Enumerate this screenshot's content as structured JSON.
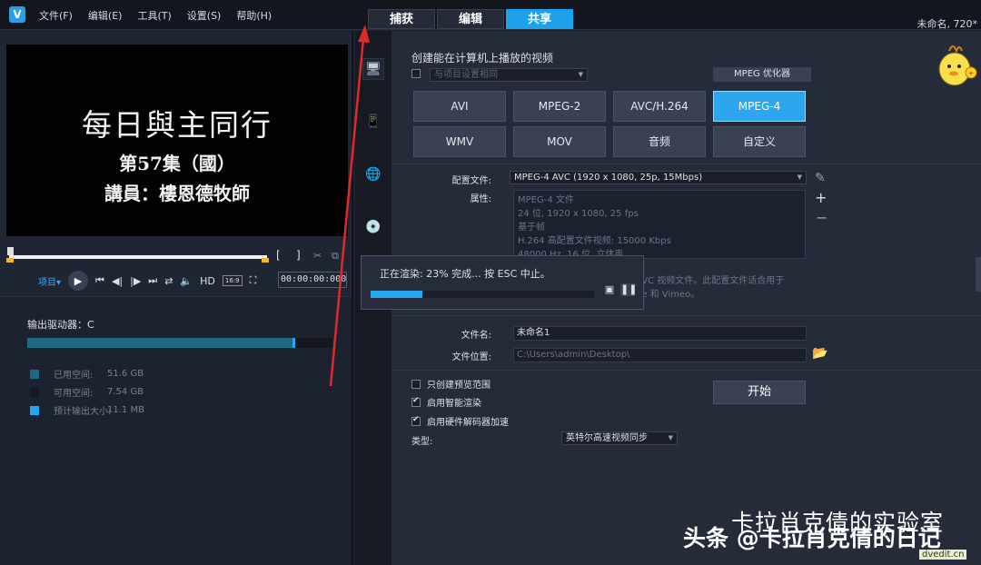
{
  "app": {
    "logo": "V",
    "menu": [
      "文件(F)",
      "编辑(E)",
      "工具(T)",
      "设置(S)",
      "帮助(H)"
    ],
    "tabs": [
      {
        "label": "捕获",
        "active": false
      },
      {
        "label": "编辑",
        "active": false
      },
      {
        "label": "共享",
        "active": true
      }
    ],
    "title_right": "未命名, 720*"
  },
  "preview": {
    "line1": "每日與主同行",
    "line2": "第57集（國）",
    "line3": "講員：樓恩德牧師",
    "mark_in": "[",
    "mark_out": "]",
    "project_label": "项目▾",
    "hd_label": "HD",
    "aspect_label": "16:9",
    "timecode": "00:00:00:000"
  },
  "storage": {
    "drive_label": "输出驱动器：C",
    "used_fraction": 0.87,
    "output_fraction": 0.004,
    "legend": [
      {
        "label": "已用空间:",
        "value": "51.6 GB",
        "color": "#1e6a82"
      },
      {
        "label": "可用空间:",
        "value": "7.54 GB",
        "color": "#141820"
      },
      {
        "label": "预计输出大小:",
        "value": "11.1 MB",
        "color": "#23a8ef"
      }
    ]
  },
  "rail": {
    "icons": [
      "computer-icon",
      "device-icon",
      "web-icon",
      "disc-icon"
    ]
  },
  "share": {
    "section_title": "创建能在计算机上播放的视频",
    "same_as_project": "与项目设置相同",
    "optimizer_label": "MPEG 优化器",
    "formats": [
      "AVI",
      "MPEG-2",
      "AVC/H.264",
      "MPEG-4",
      "WMV",
      "MOV",
      "音频",
      "自定义"
    ],
    "selected_format": "MPEG-4",
    "profile_label": "配置文件:",
    "profile_value": "MPEG-4 AVC (1920 x 1080, 25p, 15Mbps)",
    "attr_label": "属性:",
    "attr_text": "MPEG-4 文件\n24 位, 1920 x 1080, 25 fps\n基于帧\nH.264 高配置文件视频: 15000 Kbps\n48000 Hz, 16 位, 立体声",
    "desc_text_1": "AVC 视频文件。此配置文件适合用于",
    "desc_text_2": "be 和 Vimeo。",
    "filename_label": "文件名:",
    "filename_value": "未命名1",
    "location_label": "文件位置:",
    "location_value": "C:\\Users\\admin\\Desktop\\",
    "checks": [
      {
        "label": "只创建预览范围",
        "checked": false
      },
      {
        "label": "启用智能渲染",
        "checked": true
      },
      {
        "label": "启用硬件解码器加速",
        "checked": true
      }
    ],
    "type_label": "类型:",
    "type_value": "英特尔高速视频同步",
    "start_label": "开始"
  },
  "render_dialog": {
    "text": "正在渲染: 23% 完成... 按 ESC 中止。",
    "progress": 0.23
  },
  "watermark": {
    "line1": "卡拉肖克倩的实验室",
    "line2": "头条 @卡拉肖克倩的日记",
    "site": "dvedit.cn"
  }
}
